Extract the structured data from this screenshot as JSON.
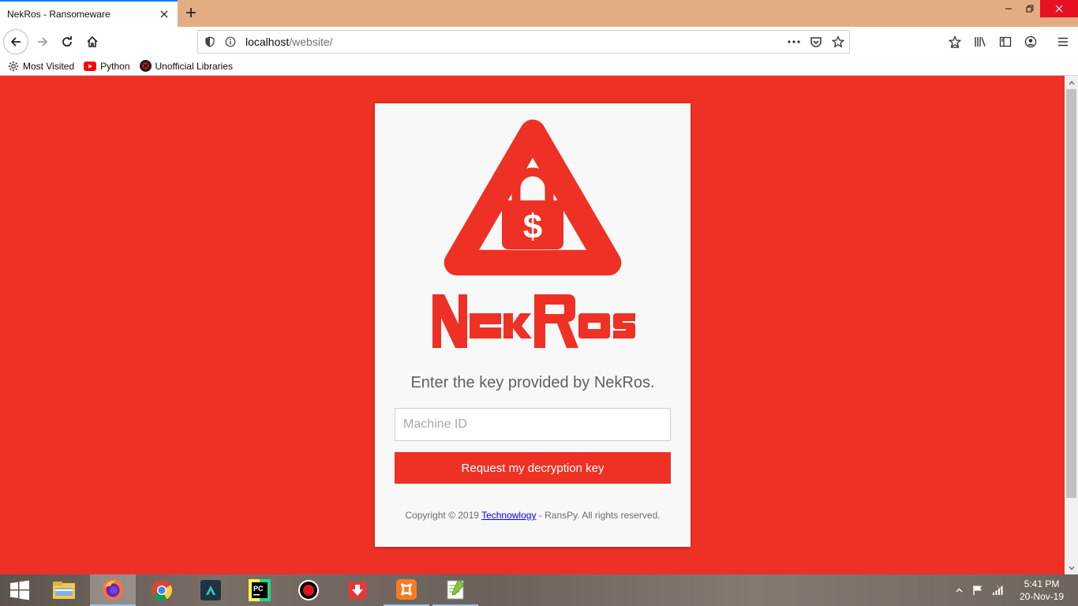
{
  "browser": {
    "tab_title": "NekRos - Ransomeware",
    "url_host": "localhost",
    "url_path": "/website/",
    "accent": "#0a84ff"
  },
  "bookmarks": [
    {
      "label": "Most Visited",
      "icon": "gear-icon"
    },
    {
      "label": "Python",
      "icon": "youtube-icon"
    },
    {
      "label": "Unofficial Libraries",
      "icon": "library-logo-icon"
    }
  ],
  "page": {
    "background": "#ee3124",
    "brand": "NekRos",
    "lead": "Enter the key provided by NekRos.",
    "input_placeholder": "Machine ID",
    "input_value": "",
    "button_label": "Request my decryption key",
    "copyright_prefix": "Copyright © 2019 ",
    "copyright_link": "Technowlogy",
    "copyright_suffix": " - RansPy. All rights reserved."
  },
  "taskbar": {
    "apps": [
      "start-icon",
      "file-explorer-icon",
      "firefox-icon",
      "chrome-icon",
      "filmora-icon",
      "pycharm-icon",
      "obs-icon",
      "downloader-icon",
      "xampp-icon",
      "notepad-plus-plus-icon"
    ],
    "time": "5:41 PM",
    "date": "20-Nov-19"
  }
}
